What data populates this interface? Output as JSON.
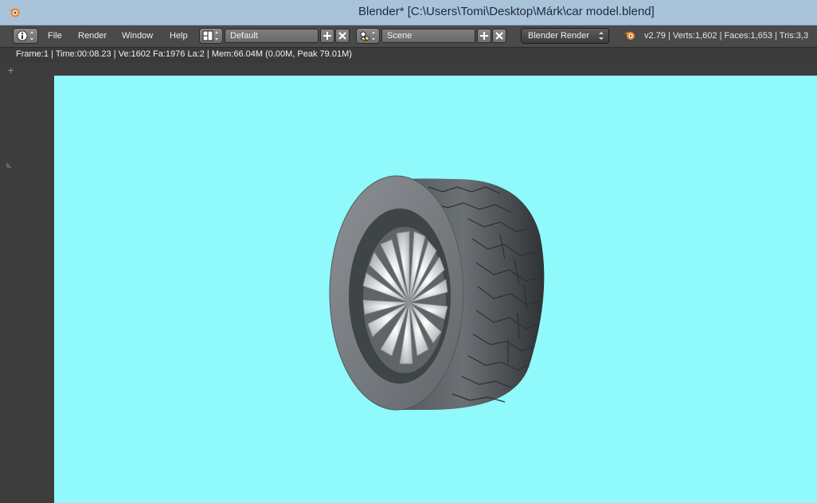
{
  "window": {
    "title": "Blender* [C:\\Users\\Tomi\\Desktop\\Márk\\car model.blend]"
  },
  "menu": {
    "items": [
      "File",
      "Render",
      "Window",
      "Help"
    ]
  },
  "layout": {
    "value": "Default"
  },
  "scene": {
    "value": "Scene"
  },
  "render_engine": {
    "value": "Blender Render"
  },
  "stats": {
    "text": "v2.79 | Verts:1,602 | Faces:1,653 | Tris:3,3"
  },
  "render_info": {
    "text": "Frame:1 | Time:00:08.23 | Ve:1602 Fa:1976 La:2 | Mem:66.04M (0.00M, Peak 79.01M)"
  },
  "colors": {
    "background": "#8ff9fb",
    "titlebar": "#a9c3db",
    "header": "#4a4a4a",
    "tire": "#6f7478"
  },
  "icons": [
    "blender-logo-icon",
    "info-editor-icon",
    "screen-layout-icon",
    "scene-icon",
    "add-icon",
    "close-icon",
    "render-icon"
  ]
}
